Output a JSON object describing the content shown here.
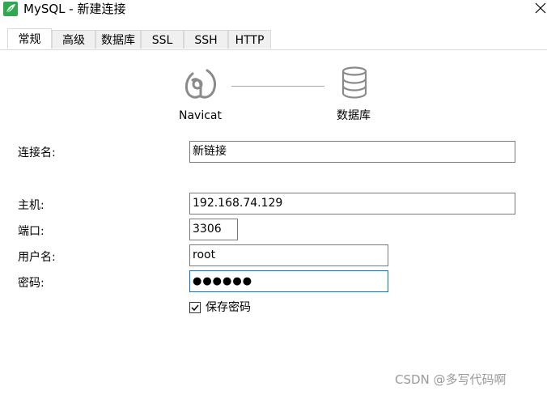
{
  "window": {
    "title": "MySQL - 新建连接"
  },
  "tabs": [
    {
      "label": "常规",
      "active": true
    },
    {
      "label": "高级",
      "active": false
    },
    {
      "label": "数据库",
      "active": false
    },
    {
      "label": "SSL",
      "active": false
    },
    {
      "label": "SSH",
      "active": false
    },
    {
      "label": "HTTP",
      "active": false
    }
  ],
  "header": {
    "left_caption": "Navicat",
    "right_caption": "数据库"
  },
  "form": {
    "connection_name": {
      "label": "连接名:",
      "value": "新链接"
    },
    "host": {
      "label": "主机:",
      "value": "192.168.74.129"
    },
    "port": {
      "label": "端口:",
      "value": "3306"
    },
    "username": {
      "label": "用户名:",
      "value": "root"
    },
    "password": {
      "label": "密码:",
      "value": "●●●●●●"
    },
    "save_password": {
      "label": "保存密码",
      "checked": true
    }
  },
  "watermark": "CSDN @多写代码啊",
  "colors": {
    "accent_focus": "#0078d7",
    "app_icon": "#2fa84f",
    "icon_gray": "#8a8a8a"
  },
  "icons": {
    "app": "mysql-leaf-icon",
    "close": "close-icon",
    "navicat": "navicat-logo-icon",
    "database": "database-icon",
    "check": "checkmark-icon"
  }
}
